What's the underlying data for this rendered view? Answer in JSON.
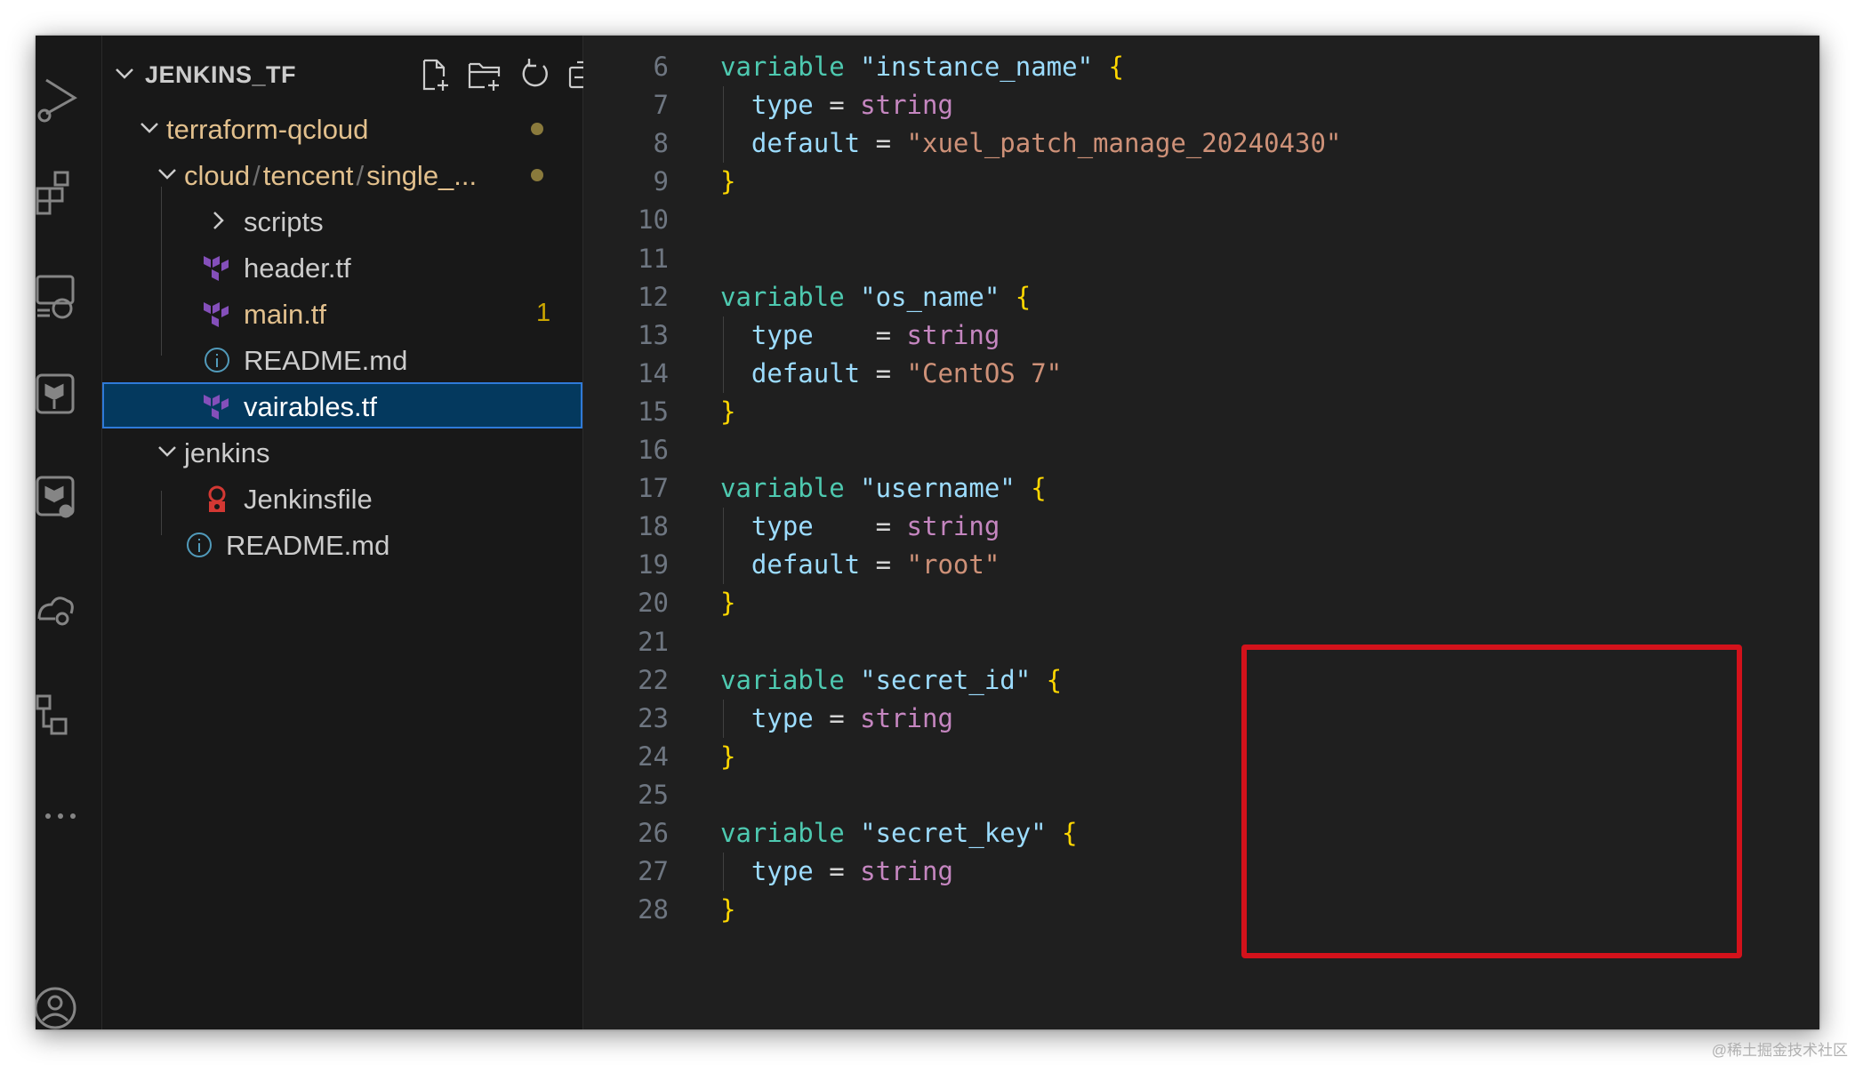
{
  "explorer": {
    "title": "JENKINS_TF",
    "actions": [
      "new-file-icon",
      "new-folder-icon",
      "refresh-icon",
      "collapse-all-icon"
    ],
    "tree": [
      {
        "label": "terraform-qcloud",
        "kind": "folder",
        "expanded": true,
        "modified": true
      },
      {
        "path_parts": [
          "cloud",
          "tencent",
          "single_..."
        ],
        "kind": "folder",
        "expanded": true,
        "modified": true
      },
      {
        "label": "scripts",
        "kind": "folder",
        "expanded": false
      },
      {
        "label": "header.tf",
        "kind": "terraform"
      },
      {
        "label": "main.tf",
        "kind": "terraform",
        "problems": "1"
      },
      {
        "label": "README.md",
        "kind": "info"
      },
      {
        "label": "vairables.tf",
        "kind": "terraform",
        "selected": true
      },
      {
        "label": "jenkins",
        "kind": "folder",
        "expanded": true
      },
      {
        "label": "Jenkinsfile",
        "kind": "jenkins"
      },
      {
        "label": "README.md",
        "kind": "info"
      }
    ]
  },
  "activity_bar": [
    "run-debug-icon",
    "extensions-icon",
    "remote-explorer-icon",
    "terraform-icon",
    "terraform-cloud-icon",
    "cloud-settings-icon",
    "source-control-graph-icon",
    "more-icon",
    "account-icon"
  ],
  "editor": {
    "lines": [
      {
        "n": "6",
        "tokens": [
          [
            "kw",
            "variable "
          ],
          [
            "str",
            "\"instance_name\""
          ],
          [
            "plain",
            " "
          ],
          [
            "brace",
            "{"
          ]
        ]
      },
      {
        "n": "7",
        "tokens": [
          [
            "plain",
            "  "
          ],
          [
            "attr",
            "type"
          ],
          [
            "plain",
            " = "
          ],
          [
            "typ",
            "string"
          ]
        ]
      },
      {
        "n": "8",
        "tokens": [
          [
            "plain",
            "  "
          ],
          [
            "attr",
            "default"
          ],
          [
            "plain",
            " = "
          ],
          [
            "val",
            "\"xuel_patch_manage_20240430\""
          ]
        ]
      },
      {
        "n": "9",
        "tokens": [
          [
            "brace",
            "}"
          ]
        ]
      },
      {
        "n": "10",
        "tokens": []
      },
      {
        "n": "11",
        "tokens": []
      },
      {
        "n": "12",
        "tokens": [
          [
            "kw",
            "variable "
          ],
          [
            "str",
            "\"os_name\""
          ],
          [
            "plain",
            " "
          ],
          [
            "brace",
            "{"
          ]
        ]
      },
      {
        "n": "13",
        "tokens": [
          [
            "plain",
            "  "
          ],
          [
            "attr",
            "type"
          ],
          [
            "plain",
            "    = "
          ],
          [
            "typ",
            "string"
          ]
        ]
      },
      {
        "n": "14",
        "tokens": [
          [
            "plain",
            "  "
          ],
          [
            "attr",
            "default"
          ],
          [
            "plain",
            " = "
          ],
          [
            "val",
            "\"CentOS 7\""
          ]
        ]
      },
      {
        "n": "15",
        "tokens": [
          [
            "brace",
            "}"
          ]
        ]
      },
      {
        "n": "16",
        "tokens": []
      },
      {
        "n": "17",
        "tokens": [
          [
            "kw",
            "variable "
          ],
          [
            "str",
            "\"username\""
          ],
          [
            "plain",
            " "
          ],
          [
            "brace",
            "{"
          ]
        ]
      },
      {
        "n": "18",
        "tokens": [
          [
            "plain",
            "  "
          ],
          [
            "attr",
            "type"
          ],
          [
            "plain",
            "    = "
          ],
          [
            "typ",
            "string"
          ]
        ]
      },
      {
        "n": "19",
        "tokens": [
          [
            "plain",
            "  "
          ],
          [
            "attr",
            "default"
          ],
          [
            "plain",
            " = "
          ],
          [
            "val",
            "\"root\""
          ]
        ]
      },
      {
        "n": "20",
        "tokens": [
          [
            "brace",
            "}"
          ]
        ]
      },
      {
        "n": "21",
        "tokens": []
      },
      {
        "n": "22",
        "tokens": [
          [
            "kw",
            "variable "
          ],
          [
            "str",
            "\"secret_id\""
          ],
          [
            "plain",
            " "
          ],
          [
            "brace",
            "{"
          ]
        ]
      },
      {
        "n": "23",
        "tokens": [
          [
            "plain",
            "  "
          ],
          [
            "attr",
            "type"
          ],
          [
            "plain",
            " = "
          ],
          [
            "typ",
            "string"
          ]
        ]
      },
      {
        "n": "24",
        "tokens": [
          [
            "brace",
            "}"
          ]
        ]
      },
      {
        "n": "25",
        "tokens": []
      },
      {
        "n": "26",
        "tokens": [
          [
            "kw",
            "variable "
          ],
          [
            "str",
            "\"secret_key\""
          ],
          [
            "plain",
            " "
          ],
          [
            "brace",
            "{"
          ]
        ]
      },
      {
        "n": "27",
        "tokens": [
          [
            "plain",
            "  "
          ],
          [
            "attr",
            "type"
          ],
          [
            "plain",
            " = "
          ],
          [
            "typ",
            "string"
          ]
        ]
      },
      {
        "n": "28",
        "tokens": [
          [
            "brace",
            "}"
          ]
        ]
      }
    ]
  },
  "watermark": "@稀土掘金技术社区",
  "colors": {
    "highlight_box": "#d3121b",
    "selection": "#04395e",
    "keyword": "#4ec9b0",
    "string_name": "#9cdcfe",
    "string_value": "#ce9178",
    "type_value": "#c586c0",
    "brace": "#ffd700"
  }
}
